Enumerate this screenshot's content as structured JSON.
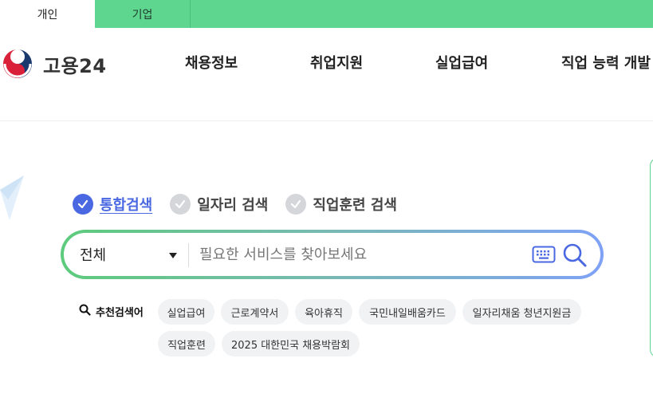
{
  "top_tabs": [
    {
      "label": "개인"
    },
    {
      "label": "기업"
    }
  ],
  "logo": {
    "text": "고용24"
  },
  "nav": [
    {
      "label": "채용정보"
    },
    {
      "label": "취업지원"
    },
    {
      "label": "실업급여"
    },
    {
      "label": "직업 능력 개발"
    }
  ],
  "search_types": [
    {
      "label": "통합검색",
      "selected": true
    },
    {
      "label": "일자리 검색",
      "selected": false
    },
    {
      "label": "직업훈련 검색",
      "selected": false
    }
  ],
  "search": {
    "scope": "전체",
    "placeholder": "필요한 서비스를 찾아보세요",
    "value": ""
  },
  "recommended": {
    "label": "추천검색어",
    "keywords": [
      "실업급여",
      "근로계약서",
      "육아휴직",
      "국민내일배움카드",
      "일자리채움 청년지원금",
      "직업훈련",
      "2025 대한민국 채용박람회"
    ]
  },
  "colors": {
    "brand_green": "#5ed690",
    "accent_blue": "#4a68e1",
    "gradient_start": "#5dcb7c",
    "gradient_end": "#7fa2f6"
  }
}
